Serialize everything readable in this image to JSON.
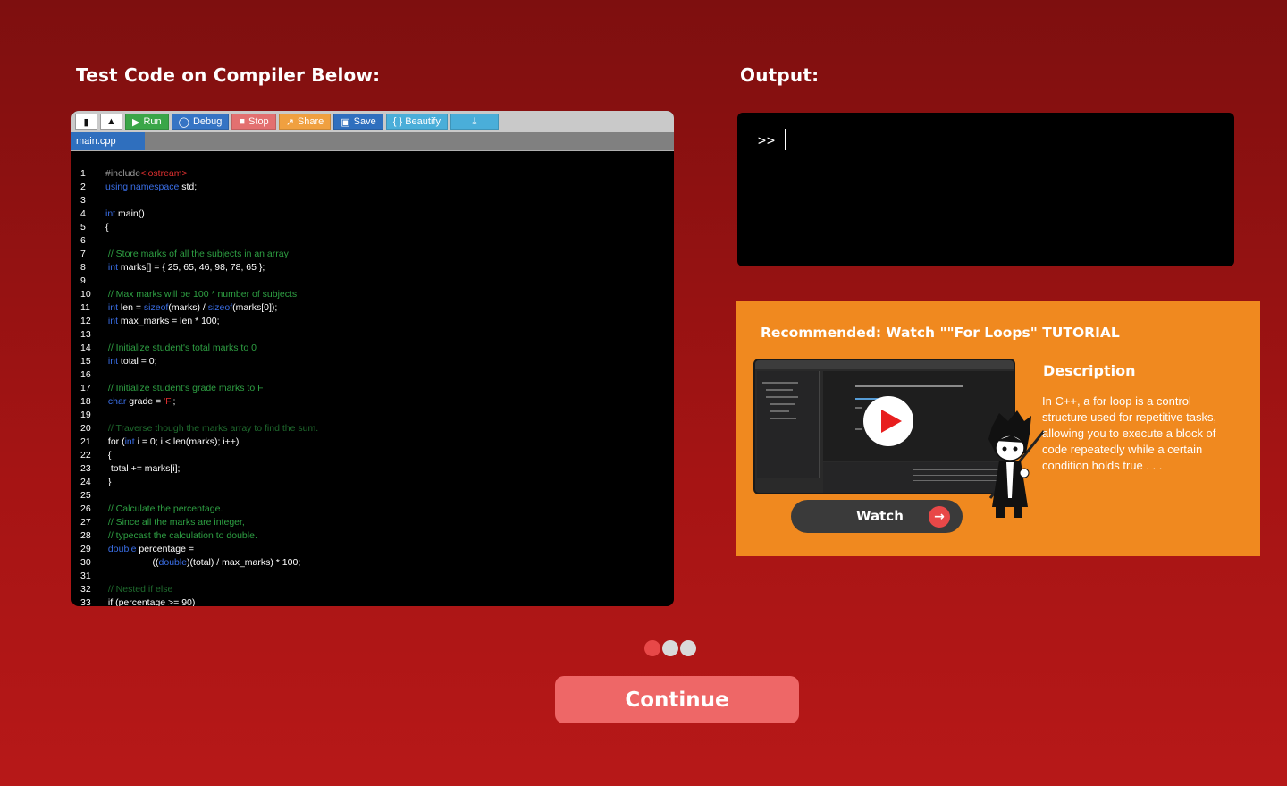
{
  "compiler": {
    "heading": "Test Code on Compiler Below:",
    "toolbar": {
      "run": "Run",
      "debug": "Debug",
      "stop": "Stop",
      "share": "Share",
      "save": "Save",
      "beautify": "{ } Beautify"
    },
    "toolbar_colors": {
      "run": "#3aa648",
      "debug": "#3674c4",
      "stop": "#e37070",
      "share": "#f0a040",
      "save": "#2f6fbe",
      "beautify": "#4aaed9",
      "download": "#4aaed9"
    },
    "file_tab": "main.cpp",
    "code_lines": [
      {
        "n": "1",
        "html": "<span class=\"cm\" style=\"color:#999\">#include</span><span class=\"str\">&lt;iostream&gt;</span>"
      },
      {
        "n": "2",
        "html": "<span class=\"kw\">using namespace</span> std;"
      },
      {
        "n": "3",
        "html": ""
      },
      {
        "n": "4",
        "html": "<span class=\"kw\">int</span> main()"
      },
      {
        "n": "5",
        "html": "{"
      },
      {
        "n": "6",
        "html": ""
      },
      {
        "n": "7",
        "html": " <span class=\"cm\">// Store marks of all the subjects in an array</span>"
      },
      {
        "n": "8",
        "html": " <span class=\"kw\">int</span> marks[] = { 25, 65, 46, 98, 78, 65 };"
      },
      {
        "n": "9",
        "html": ""
      },
      {
        "n": "10",
        "html": " <span class=\"cm\">// Max marks will be 100 * number of subjects</span>"
      },
      {
        "n": "11",
        "html": " <span class=\"kw\">int</span> len = <span class=\"kw\">sizeof</span>(marks) / <span class=\"kw\">sizeof</span>(marks[0]);"
      },
      {
        "n": "12",
        "html": " <span class=\"kw\">int</span> max_marks = len * 100;"
      },
      {
        "n": "13",
        "html": ""
      },
      {
        "n": "14",
        "html": " <span class=\"cm\">// Initialize student's total marks to 0</span>"
      },
      {
        "n": "15",
        "html": " <span class=\"kw\">int</span> total = 0;"
      },
      {
        "n": "16",
        "html": ""
      },
      {
        "n": "17",
        "html": " <span class=\"cm\">// Initialize student's grade marks to F</span>"
      },
      {
        "n": "18",
        "html": " <span class=\"kw\">char</span> grade = <span class=\"str\">'F'</span>;"
      },
      {
        "n": "19",
        "html": ""
      },
      {
        "n": "20",
        "html": " <span class=\"cm\" style=\"color:#1f6b2e\">// Traverse though the marks array to find the sum.</span>"
      },
      {
        "n": "21",
        "html": " for (<span class=\"kw\">int</span> i = 0; i &lt; len(marks); i++)"
      },
      {
        "n": "22",
        "html": " {"
      },
      {
        "n": "23",
        "html": "  total += marks[i];"
      },
      {
        "n": "24",
        "html": " }"
      },
      {
        "n": "25",
        "html": ""
      },
      {
        "n": "26",
        "html": " <span class=\"cm\">// Calculate the percentage.</span>"
      },
      {
        "n": "27",
        "html": " <span class=\"cm\">// Since all the marks are integer,</span>"
      },
      {
        "n": "28",
        "html": " <span class=\"cm\">// typecast the calculation to double.</span>"
      },
      {
        "n": "29",
        "html": " <span class=\"kw\">double</span> percentage ="
      },
      {
        "n": "30",
        "html": "                  ((<span class=\"kw\">double</span>)(total) / max_marks) * 100;"
      },
      {
        "n": "31",
        "html": ""
      },
      {
        "n": "32",
        "html": " <span class=\"cm\" style=\"color:#1f6b2e\">// Nested if else</span>"
      },
      {
        "n": "33",
        "html": " if (percentage &gt;= 90)"
      }
    ]
  },
  "output": {
    "heading": "Output:",
    "prompt": ">>"
  },
  "recommendation": {
    "title": "Recommended: Watch \"\"For Loops\" TUTORIAL",
    "watch_label": "Watch",
    "description_title": "Description",
    "description_text": "In C++, a for loop is a control structure used for repetitive tasks, allowing you to execute a block of code repeatedly while a certain condition holds true . . ."
  },
  "pager": {
    "dots": [
      "active",
      "inactive",
      "inactive"
    ],
    "active_color": "#e84848",
    "inactive_color": "#d9d9d9"
  },
  "continue_label": "Continue"
}
